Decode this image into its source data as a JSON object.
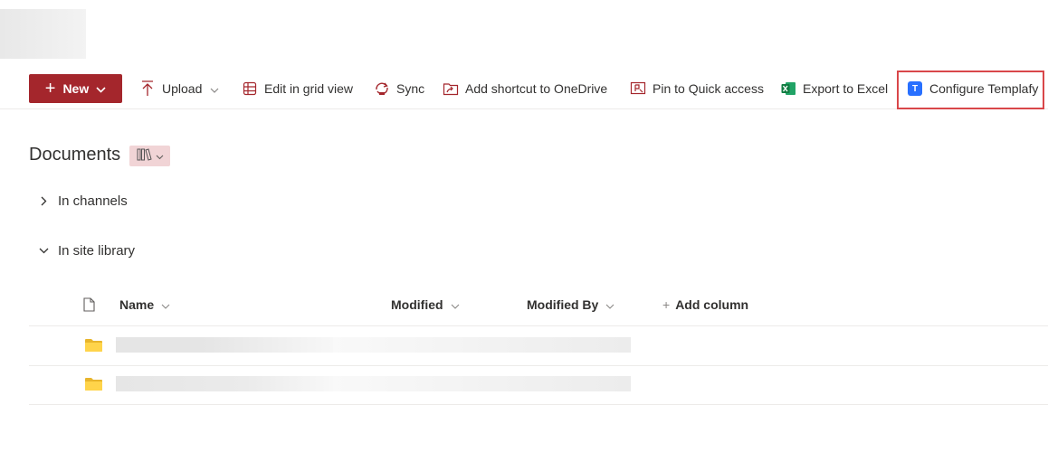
{
  "toolbar": {
    "new_label": "New",
    "upload_label": "Upload",
    "edit_grid_label": "Edit in grid view",
    "sync_label": "Sync",
    "shortcut_label": "Add shortcut to OneDrive",
    "pin_label": "Pin to Quick access",
    "export_label": "Export to Excel",
    "templafy_label": "Configure Templafy",
    "templafy_icon_letter": "T",
    "accent_color": "#a4262c",
    "highlight_color": "#d9474a",
    "templafy_icon_color": "#2870ff"
  },
  "library": {
    "title": "Documents",
    "view_icon": "library-icon",
    "sections": [
      {
        "label": "In channels",
        "expanded": false
      },
      {
        "label": "In site library",
        "expanded": true
      }
    ]
  },
  "columns": {
    "file_type_icon": "document-icon",
    "name": "Name",
    "modified": "Modified",
    "modified_by": "Modified By",
    "add_column": "Add column",
    "add_symbol": "+"
  },
  "rows": [
    {
      "type_icon": "folder-icon"
    },
    {
      "type_icon": "folder-icon"
    }
  ]
}
